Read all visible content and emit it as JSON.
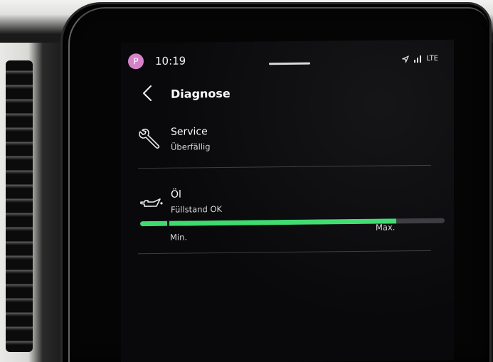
{
  "status_bar": {
    "profile_initial": "P",
    "time": "10:19",
    "network": "LTE",
    "avatar_color": "#d583c8"
  },
  "header": {
    "back_icon": "chevron-left-icon",
    "title": "Diagnose"
  },
  "service": {
    "icon": "wrench-icon",
    "title": "Service",
    "status": "Überfällig"
  },
  "oil": {
    "icon": "oil-can-icon",
    "title": "Öl",
    "status": "Füllstand OK",
    "level_fraction": 0.84,
    "min_label": "Min.",
    "max_label": "Max.",
    "bar_color": "#3ddc6f"
  }
}
